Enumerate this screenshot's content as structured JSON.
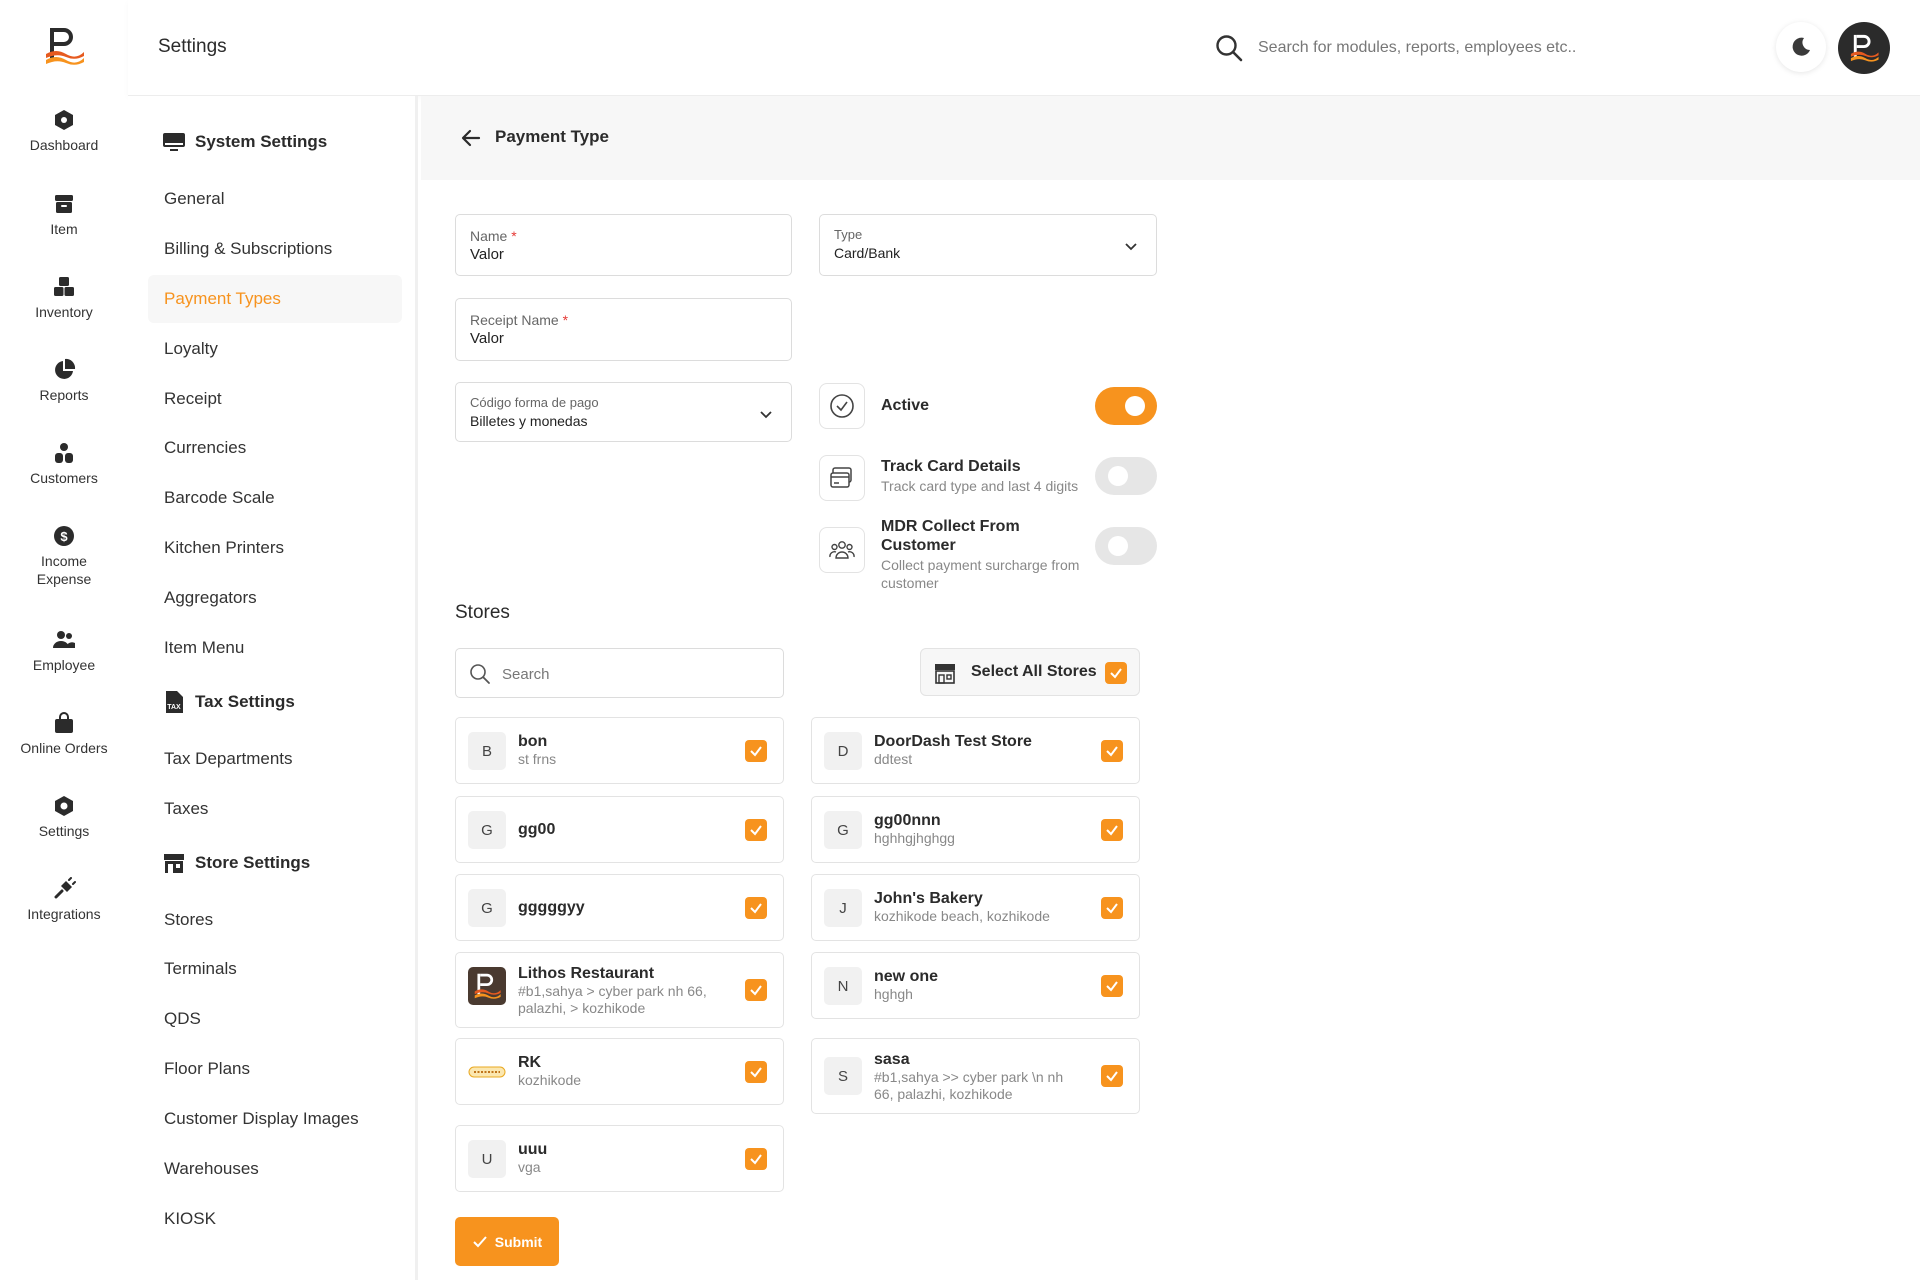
{
  "colors": {
    "accent": "#f7931e",
    "text": "#2b2b2b",
    "muted": "#888888"
  },
  "rail": [
    {
      "label": "Dashboard",
      "icon": "dashboard-icon"
    },
    {
      "label": "Item",
      "icon": "item-icon"
    },
    {
      "label": "Inventory",
      "icon": "inventory-icon"
    },
    {
      "label": "Reports",
      "icon": "reports-icon"
    },
    {
      "label": "Customers",
      "icon": "customers-icon"
    },
    {
      "label": "Income\nExpense",
      "icon": "income-expense-icon"
    },
    {
      "label": "Employee",
      "icon": "employee-icon"
    },
    {
      "label": "Online Orders",
      "icon": "online-orders-icon"
    },
    {
      "label": "Settings",
      "icon": "settings-icon"
    },
    {
      "label": "Integrations",
      "icon": "integrations-icon"
    }
  ],
  "header": {
    "title": "Settings",
    "search_placeholder": "Search for modules, reports, employees etc.."
  },
  "subnav": {
    "system_settings": "System Settings",
    "system_items": [
      "General",
      "Billing & Subscriptions",
      "Payment Types",
      "Loyalty",
      "Receipt",
      "Currencies",
      "Barcode Scale",
      "Kitchen Printers",
      "Aggregators",
      "Item Menu"
    ],
    "tax_settings": "Tax Settings",
    "tax_items": [
      "Tax Departments",
      "Taxes"
    ],
    "store_settings": "Store Settings",
    "store_items": [
      "Stores",
      "Terminals",
      "QDS",
      "Floor Plans",
      "Customer Display Images",
      "Warehouses",
      "KIOSK"
    ],
    "active": "Payment Types"
  },
  "page": {
    "title": "Payment Type",
    "name": {
      "label": "Name",
      "required": "*",
      "value": "Valor"
    },
    "type": {
      "label": "Type",
      "value": "Card/Bank"
    },
    "receipt_name": {
      "label": "Receipt Name",
      "required": "*",
      "value": "Valor"
    },
    "codigo": {
      "label": "Código forma de pago",
      "value": "Billetes y monedas"
    },
    "active": {
      "label": "Active",
      "on": true
    },
    "track_card": {
      "label": "Track Card Details",
      "desc": "Track card type and last 4 digits",
      "on": false
    },
    "mdr": {
      "label": "MDR Collect From Customer",
      "desc": "Collect payment surcharge from customer",
      "on": false
    },
    "stores_title": "Stores",
    "stores_search_placeholder": "Search",
    "select_all": "Select All Stores",
    "submit": "Submit"
  },
  "stores": {
    "left": [
      {
        "badge": "B",
        "name": "bon",
        "addr": "st frns",
        "checked": true
      },
      {
        "badge": "G",
        "name": "gg00",
        "addr": "",
        "checked": true
      },
      {
        "badge": "G",
        "name": "gggggyy",
        "addr": "",
        "checked": true
      },
      {
        "badge": "",
        "logo": "lithos-logo",
        "name": "Lithos Restaurant",
        "addr": "#b1,sahya > cyber park nh 66, palazhi, > kozhikode",
        "checked": true
      },
      {
        "badge": "",
        "logo": "fiery-hut-logo",
        "name": "RK",
        "addr": "kozhikode",
        "checked": true
      },
      {
        "badge": "U",
        "name": "uuu",
        "addr": "vga",
        "checked": true
      }
    ],
    "right": [
      {
        "badge": "D",
        "name": "DoorDash Test Store",
        "addr": "ddtest",
        "checked": true
      },
      {
        "badge": "G",
        "name": "gg00nnn",
        "addr": "hghhgjhghgg",
        "checked": true
      },
      {
        "badge": "J",
        "name": "John's Bakery",
        "addr": "kozhikode beach, kozhikode",
        "checked": true
      },
      {
        "badge": "N",
        "name": "new one",
        "addr": "hghgh",
        "checked": true
      },
      {
        "badge": "S",
        "name": "sasa",
        "addr": "#b1,sahya >> cyber park \\n nh 66, palazhi, kozhikode",
        "checked": true
      }
    ]
  }
}
